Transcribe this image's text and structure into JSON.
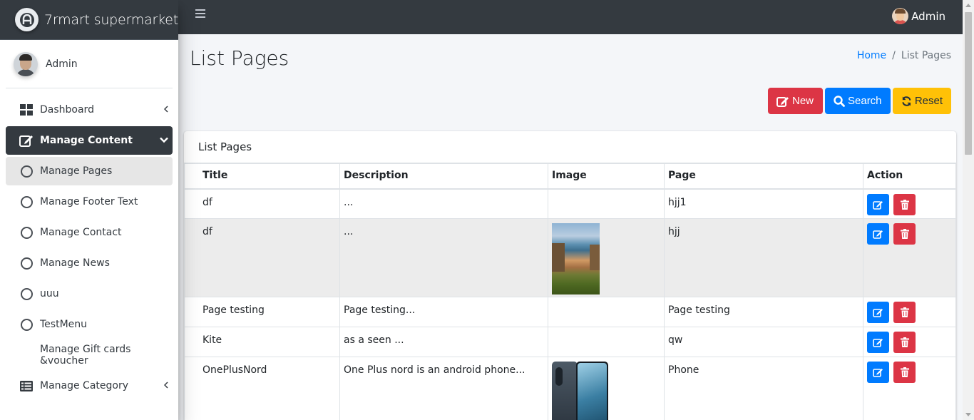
{
  "brand": {
    "name": "7rmart supermarket"
  },
  "sidebar": {
    "user": "Admin",
    "items": [
      {
        "label": "Dashboard",
        "icon": "dashboard-icon"
      },
      {
        "label": "Manage Content",
        "icon": "edit-icon"
      },
      {
        "label": "Manage Pages",
        "icon": "circle-icon"
      },
      {
        "label": "Manage Footer Text",
        "icon": "circle-icon"
      },
      {
        "label": "Manage Contact",
        "icon": "circle-icon"
      },
      {
        "label": "Manage News",
        "icon": "circle-icon"
      },
      {
        "label": "uuu",
        "icon": "circle-icon"
      },
      {
        "label": "TestMenu",
        "icon": "circle-icon"
      },
      {
        "label": "Manage Gift cards &voucher",
        "icon": ""
      },
      {
        "label": "Manage Category",
        "icon": "list-icon"
      }
    ]
  },
  "topbar": {
    "user": "Admin"
  },
  "page": {
    "title": "List Pages",
    "breadcrumb": {
      "home": "Home",
      "separator": "/",
      "current": "List Pages"
    }
  },
  "actions": {
    "new": "New",
    "search": "Search",
    "reset": "Reset"
  },
  "card": {
    "title": "List Pages",
    "columns": [
      "Title",
      "Description",
      "Image",
      "Page",
      "Action"
    ],
    "rows": [
      {
        "title": "df",
        "description": "...",
        "image": "",
        "page": "hjj1"
      },
      {
        "title": "df",
        "description": "...",
        "image": "beach-photo",
        "page": "hjj"
      },
      {
        "title": "Page testing",
        "description": "Page testing...",
        "image": "",
        "page": "Page testing"
      },
      {
        "title": "Kite",
        "description": "as a seen ...",
        "image": "",
        "page": "qw"
      },
      {
        "title": "OnePlusNord",
        "description": "One Plus nord is an android phone...",
        "image": "phone-photo",
        "page": "Phone"
      }
    ]
  },
  "colors": {
    "dark": "#343a40",
    "primary": "#007bff",
    "danger": "#dc3545",
    "warning": "#ffc107"
  }
}
